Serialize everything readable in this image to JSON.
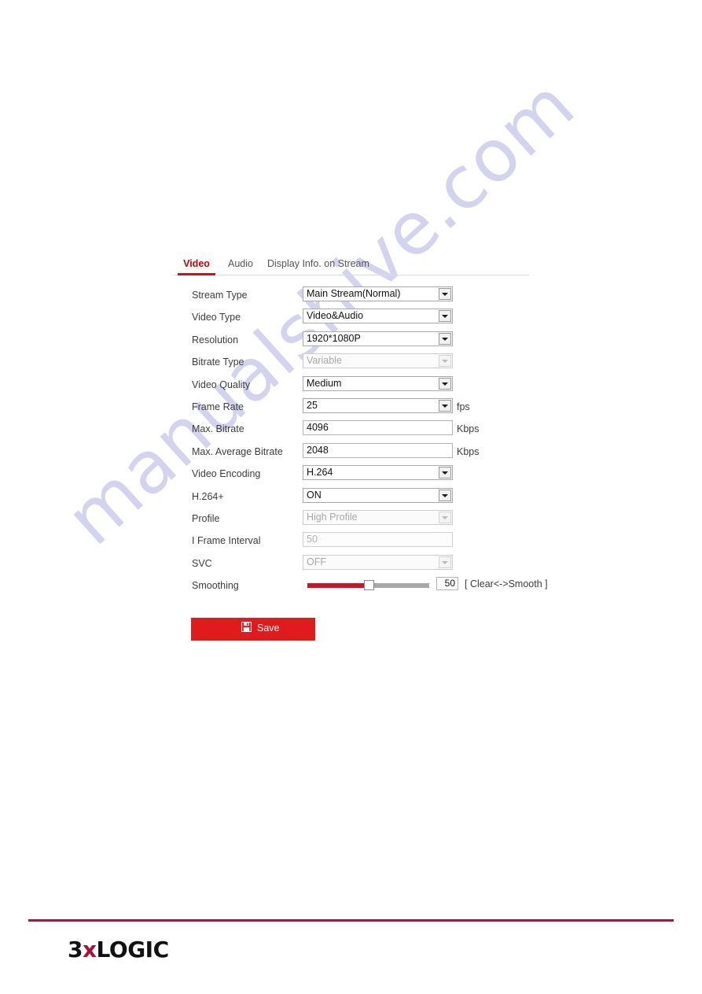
{
  "watermark": {
    "text": "manualshive.com"
  },
  "tabs": [
    {
      "label": "Video",
      "active": true
    },
    {
      "label": "Audio",
      "active": false
    },
    {
      "label": "Display Info. on Stream",
      "active": false
    }
  ],
  "form": {
    "rows": [
      {
        "label": "Stream Type",
        "control": "select",
        "value": "Main Stream(Normal)",
        "disabled": false,
        "unit": ""
      },
      {
        "label": "Video Type",
        "control": "select",
        "value": "Video&Audio",
        "disabled": false,
        "unit": ""
      },
      {
        "label": "Resolution",
        "control": "select",
        "value": "1920*1080P",
        "disabled": false,
        "unit": ""
      },
      {
        "label": "Bitrate Type",
        "control": "select",
        "value": "Variable",
        "disabled": true,
        "unit": ""
      },
      {
        "label": "Video Quality",
        "control": "select",
        "value": "Medium",
        "disabled": false,
        "unit": ""
      },
      {
        "label": "Frame Rate",
        "control": "select",
        "value": "25",
        "disabled": false,
        "unit": "fps"
      },
      {
        "label": "Max. Bitrate",
        "control": "text",
        "value": "4096",
        "disabled": false,
        "unit": "Kbps"
      },
      {
        "label": "Max. Average Bitrate",
        "control": "text",
        "value": "2048",
        "disabled": false,
        "unit": "Kbps"
      },
      {
        "label": "Video Encoding",
        "control": "select",
        "value": "H.264",
        "disabled": false,
        "unit": ""
      },
      {
        "label": "H.264+",
        "control": "select",
        "value": "ON",
        "disabled": false,
        "unit": ""
      },
      {
        "label": "Profile",
        "control": "select",
        "value": "High Profile",
        "disabled": true,
        "unit": ""
      },
      {
        "label": "I Frame Interval",
        "control": "text",
        "value": "50",
        "disabled": true,
        "unit": ""
      },
      {
        "label": "SVC",
        "control": "select",
        "value": "OFF",
        "disabled": true,
        "unit": ""
      }
    ],
    "smoothing": {
      "label": "Smoothing",
      "value": "50",
      "percent": 50,
      "hint": "[ Clear<->Smooth ]"
    }
  },
  "save": {
    "label": "Save",
    "icon": "save-floppy-icon"
  },
  "footer": {
    "logo_part1": "3",
    "logo_part2": "x",
    "logo_part3": "LOGIC"
  },
  "colors": {
    "accent_red": "#cc0000",
    "button_red": "#e01b1b",
    "slider_red": "#cc1422",
    "footer_crimson": "#9e1b3e",
    "watermark": "#d3d3f0"
  }
}
